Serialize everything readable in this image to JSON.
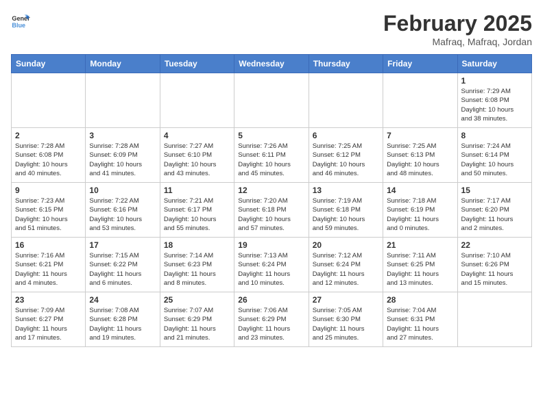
{
  "logo": {
    "line1": "General",
    "line2": "Blue"
  },
  "title": "February 2025",
  "subtitle": "Mafraq, Mafraq, Jordan",
  "headers": [
    "Sunday",
    "Monday",
    "Tuesday",
    "Wednesday",
    "Thursday",
    "Friday",
    "Saturday"
  ],
  "weeks": [
    [
      {
        "day": "",
        "info": ""
      },
      {
        "day": "",
        "info": ""
      },
      {
        "day": "",
        "info": ""
      },
      {
        "day": "",
        "info": ""
      },
      {
        "day": "",
        "info": ""
      },
      {
        "day": "",
        "info": ""
      },
      {
        "day": "1",
        "info": "Sunrise: 7:29 AM\nSunset: 6:08 PM\nDaylight: 10 hours\nand 38 minutes."
      }
    ],
    [
      {
        "day": "2",
        "info": "Sunrise: 7:28 AM\nSunset: 6:08 PM\nDaylight: 10 hours\nand 40 minutes."
      },
      {
        "day": "3",
        "info": "Sunrise: 7:28 AM\nSunset: 6:09 PM\nDaylight: 10 hours\nand 41 minutes."
      },
      {
        "day": "4",
        "info": "Sunrise: 7:27 AM\nSunset: 6:10 PM\nDaylight: 10 hours\nand 43 minutes."
      },
      {
        "day": "5",
        "info": "Sunrise: 7:26 AM\nSunset: 6:11 PM\nDaylight: 10 hours\nand 45 minutes."
      },
      {
        "day": "6",
        "info": "Sunrise: 7:25 AM\nSunset: 6:12 PM\nDaylight: 10 hours\nand 46 minutes."
      },
      {
        "day": "7",
        "info": "Sunrise: 7:25 AM\nSunset: 6:13 PM\nDaylight: 10 hours\nand 48 minutes."
      },
      {
        "day": "8",
        "info": "Sunrise: 7:24 AM\nSunset: 6:14 PM\nDaylight: 10 hours\nand 50 minutes."
      }
    ],
    [
      {
        "day": "9",
        "info": "Sunrise: 7:23 AM\nSunset: 6:15 PM\nDaylight: 10 hours\nand 51 minutes."
      },
      {
        "day": "10",
        "info": "Sunrise: 7:22 AM\nSunset: 6:16 PM\nDaylight: 10 hours\nand 53 minutes."
      },
      {
        "day": "11",
        "info": "Sunrise: 7:21 AM\nSunset: 6:17 PM\nDaylight: 10 hours\nand 55 minutes."
      },
      {
        "day": "12",
        "info": "Sunrise: 7:20 AM\nSunset: 6:18 PM\nDaylight: 10 hours\nand 57 minutes."
      },
      {
        "day": "13",
        "info": "Sunrise: 7:19 AM\nSunset: 6:18 PM\nDaylight: 10 hours\nand 59 minutes."
      },
      {
        "day": "14",
        "info": "Sunrise: 7:18 AM\nSunset: 6:19 PM\nDaylight: 11 hours\nand 0 minutes."
      },
      {
        "day": "15",
        "info": "Sunrise: 7:17 AM\nSunset: 6:20 PM\nDaylight: 11 hours\nand 2 minutes."
      }
    ],
    [
      {
        "day": "16",
        "info": "Sunrise: 7:16 AM\nSunset: 6:21 PM\nDaylight: 11 hours\nand 4 minutes."
      },
      {
        "day": "17",
        "info": "Sunrise: 7:15 AM\nSunset: 6:22 PM\nDaylight: 11 hours\nand 6 minutes."
      },
      {
        "day": "18",
        "info": "Sunrise: 7:14 AM\nSunset: 6:23 PM\nDaylight: 11 hours\nand 8 minutes."
      },
      {
        "day": "19",
        "info": "Sunrise: 7:13 AM\nSunset: 6:24 PM\nDaylight: 11 hours\nand 10 minutes."
      },
      {
        "day": "20",
        "info": "Sunrise: 7:12 AM\nSunset: 6:24 PM\nDaylight: 11 hours\nand 12 minutes."
      },
      {
        "day": "21",
        "info": "Sunrise: 7:11 AM\nSunset: 6:25 PM\nDaylight: 11 hours\nand 13 minutes."
      },
      {
        "day": "22",
        "info": "Sunrise: 7:10 AM\nSunset: 6:26 PM\nDaylight: 11 hours\nand 15 minutes."
      }
    ],
    [
      {
        "day": "23",
        "info": "Sunrise: 7:09 AM\nSunset: 6:27 PM\nDaylight: 11 hours\nand 17 minutes."
      },
      {
        "day": "24",
        "info": "Sunrise: 7:08 AM\nSunset: 6:28 PM\nDaylight: 11 hours\nand 19 minutes."
      },
      {
        "day": "25",
        "info": "Sunrise: 7:07 AM\nSunset: 6:29 PM\nDaylight: 11 hours\nand 21 minutes."
      },
      {
        "day": "26",
        "info": "Sunrise: 7:06 AM\nSunset: 6:29 PM\nDaylight: 11 hours\nand 23 minutes."
      },
      {
        "day": "27",
        "info": "Sunrise: 7:05 AM\nSunset: 6:30 PM\nDaylight: 11 hours\nand 25 minutes."
      },
      {
        "day": "28",
        "info": "Sunrise: 7:04 AM\nSunset: 6:31 PM\nDaylight: 11 hours\nand 27 minutes."
      },
      {
        "day": "",
        "info": ""
      }
    ]
  ]
}
